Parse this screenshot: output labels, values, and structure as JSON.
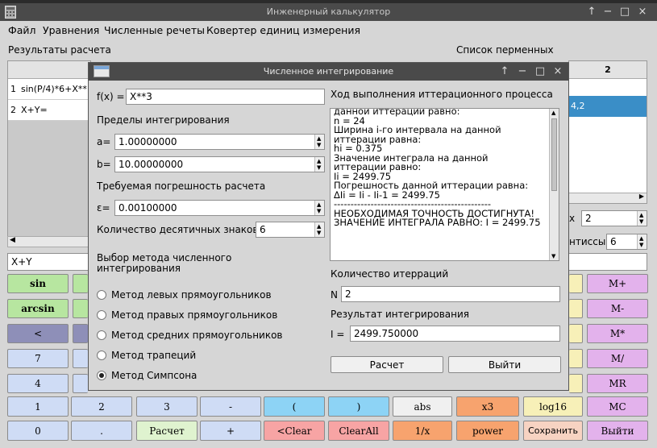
{
  "app": {
    "title": "Инженерный калькулятор",
    "controls": [
      "↑",
      "−",
      "□",
      "×"
    ]
  },
  "menu": [
    "Файл",
    "Уравнения",
    "Численные речеты",
    "Ковертер единиц измерения"
  ],
  "left": {
    "results_label": "Результаты расчета",
    "rows": [
      {
        "num": "1",
        "text": "sin(P/4)*6+X**"
      },
      {
        "num": "2",
        "text": "X+Y="
      }
    ],
    "expression": "X+Y"
  },
  "right": {
    "vars_label": "Список перменных",
    "col_header": "2",
    "selected_value": "4,2",
    "spin1_label": "х",
    "spin1_value": "2",
    "spin2_label": "нтиссы",
    "spin2_value": "6"
  },
  "keypad": {
    "row1": [
      "sin",
      "M+"
    ],
    "row2": [
      "arcsin",
      "M-"
    ],
    "row3": [
      "<",
      "M*"
    ],
    "row4": [
      "7",
      "M/"
    ],
    "row5": [
      "4",
      "MR"
    ],
    "row6": [
      "1",
      "2",
      "3",
      "-",
      "(",
      ")",
      "abs",
      "x3",
      "log16",
      "MC"
    ],
    "row7": [
      "0",
      ".",
      "Расчет",
      "+",
      "<Clear",
      "ClearAll",
      "1/x",
      "power",
      "Сохранить",
      "Выйти"
    ]
  },
  "dialog": {
    "title": "Численное интегрирование",
    "controls": [
      "↑",
      "−",
      "□",
      "×"
    ],
    "fx_label": "f(x) =",
    "fx_value": "X**3",
    "limits_label": "Пределы интегрирования",
    "a_label": "a=",
    "a_value": "1.00000000",
    "b_label": "b=",
    "b_value": "10.00000000",
    "err_label": "Требуемая погрешность расчета",
    "eps_label": "ε=",
    "eps_value": "0.00100000",
    "digits_label": "Количество десятичных знаков",
    "digits_value": "6",
    "method_label": "Выбор метода численного интегрирования",
    "methods": [
      {
        "label": "Метод левых прямоугольников",
        "selected": false
      },
      {
        "label": "Метод правых прямоугольников",
        "selected": false
      },
      {
        "label": "Метод средних прямоугольников",
        "selected": false
      },
      {
        "label": "Метод трапеций",
        "selected": false
      },
      {
        "label": "Метод Симпсона",
        "selected": true
      }
    ],
    "log_label": "Ход выполнения иттерационного процесса",
    "log_lines": [
      "данной иттерации равно:",
      " n = 24",
      "Ширина i-го интервала на данной",
      "иттерации равна:",
      " hi = 0.375",
      "Значение интеграла на данной",
      "иттерации равно:",
      " Ii = 2499.75",
      "Погрешность данной  иттерации равна:",
      " ΔIi = Ii - Ii-1 = 2499.75",
      "-----------------------------------------------",
      "НЕОБХОДИМАЯ ТОЧНОСТЬ ДОСТИГНУТА!",
      "ЗНАЧЕНИЕ ИНТЕГРАЛА РАВНО: I = 2499.75"
    ],
    "iter_label": "Количество итерраций",
    "n_label": "N",
    "n_value": "2",
    "result_label": "Результат интегрирования",
    "i_label": "I =",
    "i_value": "2499.750000",
    "calc_button": "Расчет",
    "exit_button": "Выйти"
  },
  "colors": {
    "green": "#b7e6a0",
    "purple": "#e3b2ec",
    "blue_gray": "#8e8fb8",
    "light_blue": "#cfdcf5",
    "cyan": "#8dd3f5",
    "orange": "#f7a36e",
    "yellow": "#f7f0b8",
    "red": "#f7a4a4",
    "light_green": "#dff3cf"
  }
}
